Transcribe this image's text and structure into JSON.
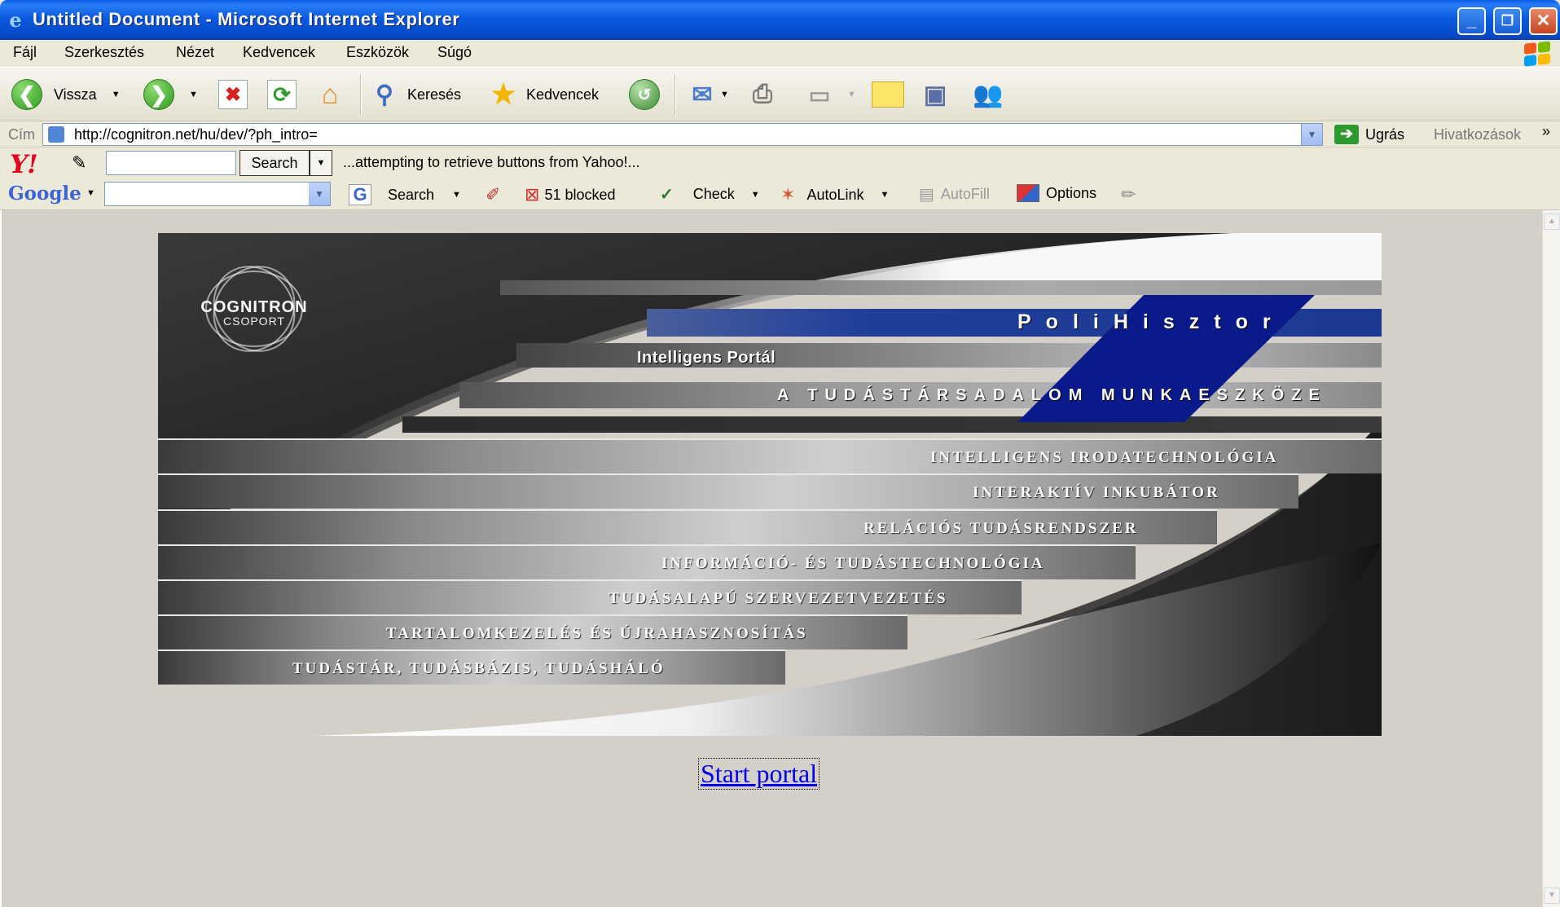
{
  "window": {
    "title": "Untitled Document - Microsoft Internet Explorer",
    "buttons": {
      "minimize": "_",
      "restore": "❐",
      "close": "✕"
    }
  },
  "menu": [
    "Fájl",
    "Szerkesztés",
    "Nézet",
    "Kedvencek",
    "Eszközök",
    "Súgó"
  ],
  "toolbar": {
    "back_label": "Vissza",
    "search_label": "Keresés",
    "favorites_label": "Kedvencek"
  },
  "address": {
    "label": "Cím",
    "url": "http://cognitron.net/hu/dev/?ph_intro=",
    "go_label": "Ugrás",
    "links_label": "Hivatkozások",
    "more": "»"
  },
  "yahoo": {
    "logo": "Y!",
    "search_value": "",
    "search_button": "Search",
    "status": "...attempting to retrieve buttons from Yahoo!..."
  },
  "google": {
    "logo": "Google",
    "search_value": "",
    "search_label": "Search",
    "blocked_label": "51 blocked",
    "check_label": "Check",
    "autolink_label": "AutoLink",
    "autofill_label": "AutoFill",
    "options_label": "Options"
  },
  "banner": {
    "logo_name": "COGNITRON",
    "logo_sub": "CSOPORT",
    "product": "PoliHisztor",
    "tagline": "Intelligens Portál",
    "motto": "A TUDÁSTÁRSADALOM MUNKAESZKÖZE",
    "items": [
      "INTELLIGENS IRODATECHNOLÓGIA",
      "INTERAKTÍV INKUBÁTOR",
      "RELÁCIÓS TUDÁSRENDSZER",
      "INFORMÁCIÓ- ÉS TUDÁSTECHNOLÓGIA",
      "TUDÁSALAPÚ SZERVEZETVEZETÉS",
      "TARTALOMKEZELÉS ÉS ÚJRAHASZNOSÍTÁS",
      "TUDÁSTÁR,  TUDÁSBÁZIS,  TUDÁSHÁLÓ"
    ]
  },
  "start_link": "Start portal",
  "colors": {
    "titlebar": "#0a5be6",
    "link": "#0000ee",
    "product_band": "#1a3e9a"
  }
}
